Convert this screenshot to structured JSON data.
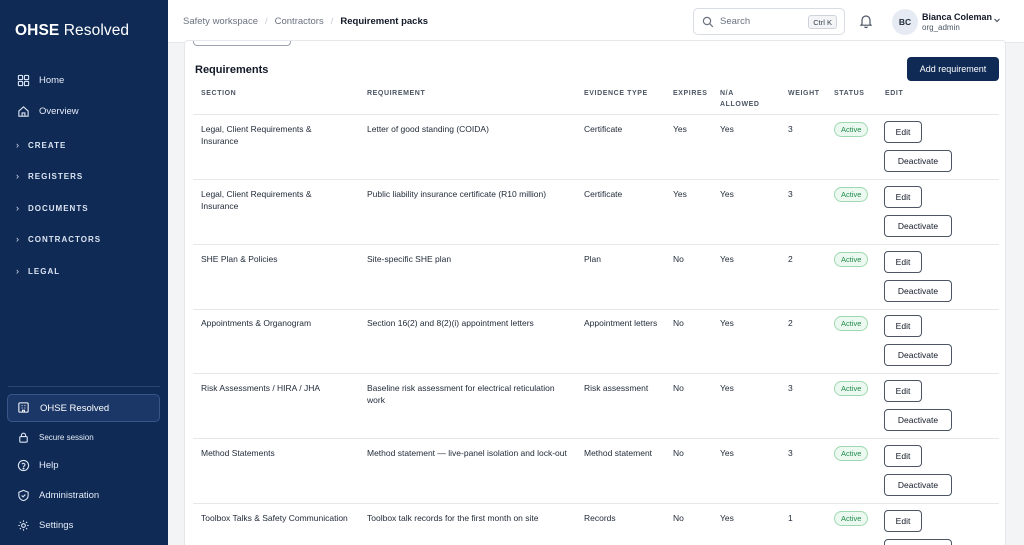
{
  "brand": {
    "name_bold": "OHSE",
    "name_light": " Resolved"
  },
  "sidebar": {
    "items": [
      {
        "label": "Home",
        "icon": "grid-icon"
      },
      {
        "label": "Overview",
        "icon": "house-icon"
      }
    ],
    "groups": [
      {
        "label": "CREATE"
      },
      {
        "label": "REGISTERS"
      },
      {
        "label": "DOCUMENTS"
      },
      {
        "label": "CONTRACTORS"
      },
      {
        "label": "LEGAL"
      }
    ],
    "org": {
      "label": "OHSE Resolved",
      "icon": "building-icon"
    },
    "session": {
      "label": "Secure session",
      "icon": "lock-icon"
    },
    "footer": [
      {
        "label": "Help",
        "icon": "help-icon"
      },
      {
        "label": "Administration",
        "icon": "shield-icon"
      },
      {
        "label": "Settings",
        "icon": "gear-icon"
      }
    ]
  },
  "topbar": {
    "breadcrumb": [
      "Safety workspace",
      "Contractors",
      "Requirement packs"
    ],
    "search": {
      "placeholder": "Search",
      "shortcut": "Ctrl K"
    },
    "user": {
      "initials": "BC",
      "name": "Bianca Coleman",
      "role": "org_admin"
    }
  },
  "main": {
    "title": "Requirements",
    "add_button": "Add requirement",
    "columns": {
      "section": "SECTION",
      "requirement": "REQUIREMENT",
      "evidence": "EVIDENCE TYPE",
      "expires": "EXPIRES",
      "na": "N/A\nALLOWED",
      "weight": "WEIGHT",
      "status": "STATUS",
      "edit": "EDIT"
    },
    "edit_label": "Edit",
    "deactivate_label": "Deactivate",
    "rows": [
      {
        "section": "Legal, Client Requirements & Insurance",
        "requirement": "Letter of good standing (COIDA)",
        "evidence": "Certificate",
        "expires": "Yes",
        "na": "Yes",
        "weight": "3",
        "status": "Active"
      },
      {
        "section": "Legal, Client Requirements & Insurance",
        "requirement": "Public liability insurance certificate (R10 million)",
        "evidence": "Certificate",
        "expires": "Yes",
        "na": "Yes",
        "weight": "3",
        "status": "Active"
      },
      {
        "section": "SHE Plan & Policies",
        "requirement": "Site-specific SHE plan",
        "evidence": "Plan",
        "expires": "No",
        "na": "Yes",
        "weight": "2",
        "status": "Active"
      },
      {
        "section": "Appointments & Organogram",
        "requirement": "Section 16(2) and 8(2)(i) appointment letters",
        "evidence": "Appointment letters",
        "expires": "No",
        "na": "Yes",
        "weight": "2",
        "status": "Active"
      },
      {
        "section": "Risk Assessments / HIRA / JHA",
        "requirement": "Baseline risk assessment for electrical reticulation work",
        "evidence": "Risk assessment",
        "expires": "No",
        "na": "Yes",
        "weight": "3",
        "status": "Active"
      },
      {
        "section": "Method Statements",
        "requirement": "Method statement — live-panel isolation and lock-out",
        "evidence": "Method statement",
        "expires": "No",
        "na": "Yes",
        "weight": "3",
        "status": "Active"
      },
      {
        "section": "Toolbox Talks & Safety Communication",
        "requirement": "Toolbox talk records for the first month on site",
        "evidence": "Records",
        "expires": "No",
        "na": "Yes",
        "weight": "1",
        "status": "Active"
      }
    ]
  }
}
